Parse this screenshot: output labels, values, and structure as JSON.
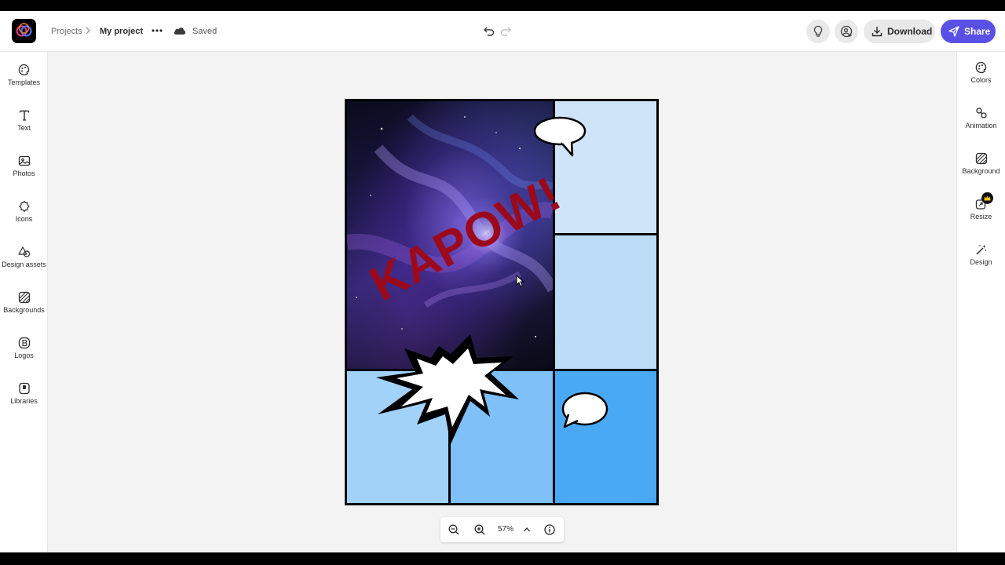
{
  "header": {
    "breadcrumb_root": "Projects",
    "breadcrumb_current": "My project",
    "save_status": "Saved",
    "download_label": "Download",
    "share_label": "Share"
  },
  "left_rail": {
    "items": [
      {
        "label": "Templates",
        "icon": "templates-icon"
      },
      {
        "label": "Text",
        "icon": "text-icon"
      },
      {
        "label": "Photos",
        "icon": "photos-icon"
      },
      {
        "label": "Icons",
        "icon": "icons-icon"
      },
      {
        "label": "Design assets",
        "icon": "design-assets-icon"
      },
      {
        "label": "Backgrounds",
        "icon": "backgrounds-icon"
      },
      {
        "label": "Logos",
        "icon": "logos-icon"
      },
      {
        "label": "Libraries",
        "icon": "libraries-icon"
      }
    ]
  },
  "right_rail": {
    "items": [
      {
        "label": "Colors",
        "icon": "palette-icon"
      },
      {
        "label": "Animation",
        "icon": "animation-icon"
      },
      {
        "label": "Background",
        "icon": "background-icon"
      },
      {
        "label": "Resize",
        "icon": "resize-icon"
      },
      {
        "label": "Design",
        "icon": "magic-wand-icon"
      }
    ]
  },
  "canvas": {
    "headline": "KAPOW!",
    "headline_color": "#9b0a1c",
    "panel_colors": [
      "#cfe4f8",
      "#bcdcf7",
      "#a3d2f8",
      "#7ec0f7",
      "#4aa9f5"
    ]
  },
  "zoom": {
    "level": "57%"
  },
  "colors": {
    "accent": "#5a50e6"
  }
}
